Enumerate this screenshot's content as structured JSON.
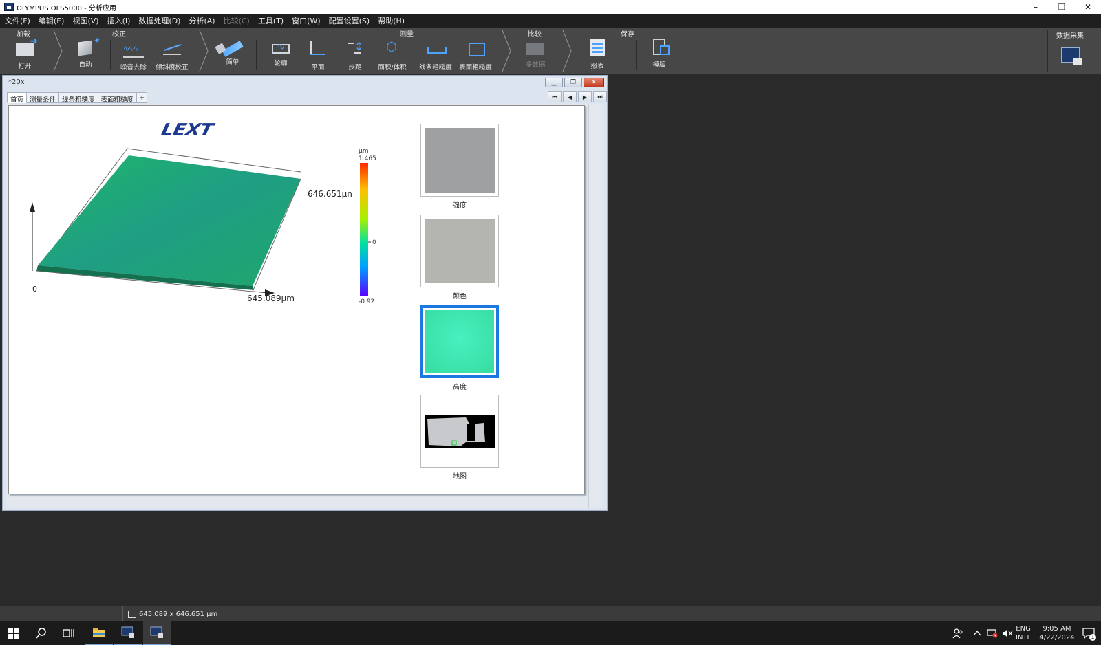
{
  "window": {
    "title": "OLYMPUS OLS5000 - 分析应用",
    "minimize": "–",
    "restore": "❐",
    "close": "✕"
  },
  "menu": [
    {
      "label": "文件(F)",
      "enabled": true
    },
    {
      "label": "编辑(E)",
      "enabled": true
    },
    {
      "label": "视图(V)",
      "enabled": true
    },
    {
      "label": "插入(I)",
      "enabled": true
    },
    {
      "label": "数据处理(D)",
      "enabled": true
    },
    {
      "label": "分析(A)",
      "enabled": true
    },
    {
      "label": "比较(C)",
      "enabled": false
    },
    {
      "label": "工具(T)",
      "enabled": true
    },
    {
      "label": "窗口(W)",
      "enabled": true
    },
    {
      "label": "配置设置(S)",
      "enabled": true
    },
    {
      "label": "帮助(H)",
      "enabled": true
    }
  ],
  "ribbon": {
    "groups": {
      "load": "加载",
      "calibrate": "校正",
      "measure": "测量",
      "compare": "比较",
      "save": "保存",
      "acquire": "数据采集"
    },
    "tools": {
      "open": "打开",
      "auto": "自动",
      "noise": "噪音去除",
      "tilt": "倾斜度校正",
      "simple": "简单",
      "profile": "轮廓",
      "plane": "平面",
      "step": "步距",
      "area_volume": "面积/体积",
      "line_roughness": "线条粗糙度",
      "surface_roughness": "表面粗糙度",
      "multi_data": "多数据",
      "report": "报表",
      "template": "模版"
    }
  },
  "document": {
    "title": "*20x",
    "tabs": [
      "首页",
      "测量条件",
      "线条粗糙度",
      "表面粗糙度"
    ],
    "add_tab": "+",
    "nav": [
      "⏮",
      "◀",
      "▶",
      "⏭"
    ],
    "logo": "LEXT",
    "plot3d": {
      "x_extent": "645.089µm",
      "y_extent": "646.651µn",
      "origin": "0",
      "surface_color": "#1fa56a"
    },
    "colorbar": {
      "unit": "µm",
      "max": "1.465",
      "zero": "0",
      "min": "-0.92"
    },
    "thumbnails": [
      {
        "label": "强度",
        "color": "#9ea0a2"
      },
      {
        "label": "颜色",
        "color": "#b4b5b0"
      },
      {
        "label": "高度",
        "color": "#3ce6b0",
        "selected": true
      },
      {
        "label": "地图",
        "color": "#000000"
      }
    ]
  },
  "status": {
    "size": "645.089 x 646.651 µm"
  },
  "taskbar": {
    "lang_top": "ENG",
    "lang_bottom": "INTL",
    "time": "9:05 AM",
    "date": "4/22/2024",
    "notif_count": "1"
  }
}
